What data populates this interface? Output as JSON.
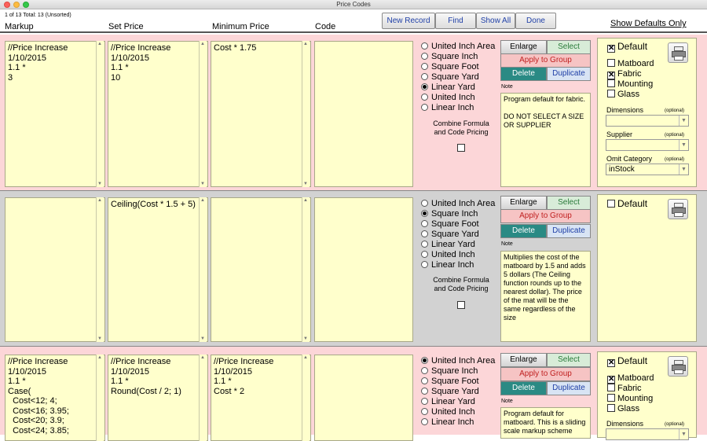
{
  "window": {
    "title": "Price Codes"
  },
  "header": {
    "record_info": "1 of 13  Total: 13  (Unsorted)",
    "columns": [
      "Markup",
      "Set Price",
      "Minimum Price",
      "Code"
    ],
    "buttons": {
      "new_record": "New Record",
      "find": "Find",
      "show_all": "Show All",
      "done": "Done"
    },
    "show_defaults": "Show Defaults Only"
  },
  "labels": {
    "units": [
      "United Inch Area",
      "Square Inch",
      "Square Foot",
      "Square Yard",
      "Linear Yard",
      "United Inch",
      "Linear Inch"
    ],
    "combine": "Combine Formula\nand Code Pricing",
    "enlarge": "Enlarge",
    "select": "Select",
    "apply_group": "Apply to Group",
    "delete": "Delete",
    "duplicate": "Duplicate",
    "note": "Note",
    "default": "Default",
    "materials": [
      "Matboard",
      "Fabric",
      "Mounting",
      "Glass"
    ],
    "dimensions": "Dimensions",
    "supplier": "Supplier",
    "omit_category": "Omit Category",
    "optional": "(optional)"
  },
  "records": [
    {
      "markup": "//Price Increase\n1/10/2015\n1.1 *\n3",
      "set_price": "//Price Increase\n1/10/2015\n1.1 *\n10",
      "min_price": "Cost * 1.75",
      "code": "",
      "unit_selected": 4,
      "note": "Program default for fabric.\n\nDO NOT SELECT A SIZE OR SUPPLIER",
      "default_checked": true,
      "materials_checked": [
        false,
        true,
        false,
        false
      ],
      "dimensions_value": "",
      "supplier_value": "",
      "omit_category_value": "inStock"
    },
    {
      "markup": "",
      "set_price": "Ceiling(Cost * 1.5 + 5)",
      "min_price": "",
      "code": "",
      "unit_selected": 1,
      "note": "Multiplies the cost of the matboard by 1.5 and adds 5 dollars (The Ceiling function rounds up to the nearest dollar). The price of the mat will be the same regardless of the size",
      "default_checked": false
    },
    {
      "markup": "//Price Increase\n1/10/2015\n1.1 *\nCase(\n  Cost<12; 4;\n  Cost<16; 3.95;\n  Cost<20; 3.9;\n  Cost<24; 3.85;",
      "set_price": "//Price Increase\n1/10/2015\n1.1 *\nRound(Cost / 2; 1)",
      "min_price": "//Price Increase\n1/10/2015\n1.1 *\nCost * 2",
      "code": "",
      "unit_selected": 0,
      "note": "Program default for matboard. This is a sliding scale markup scheme",
      "default_checked": true,
      "materials_checked": [
        true,
        false,
        false,
        false
      ]
    }
  ]
}
